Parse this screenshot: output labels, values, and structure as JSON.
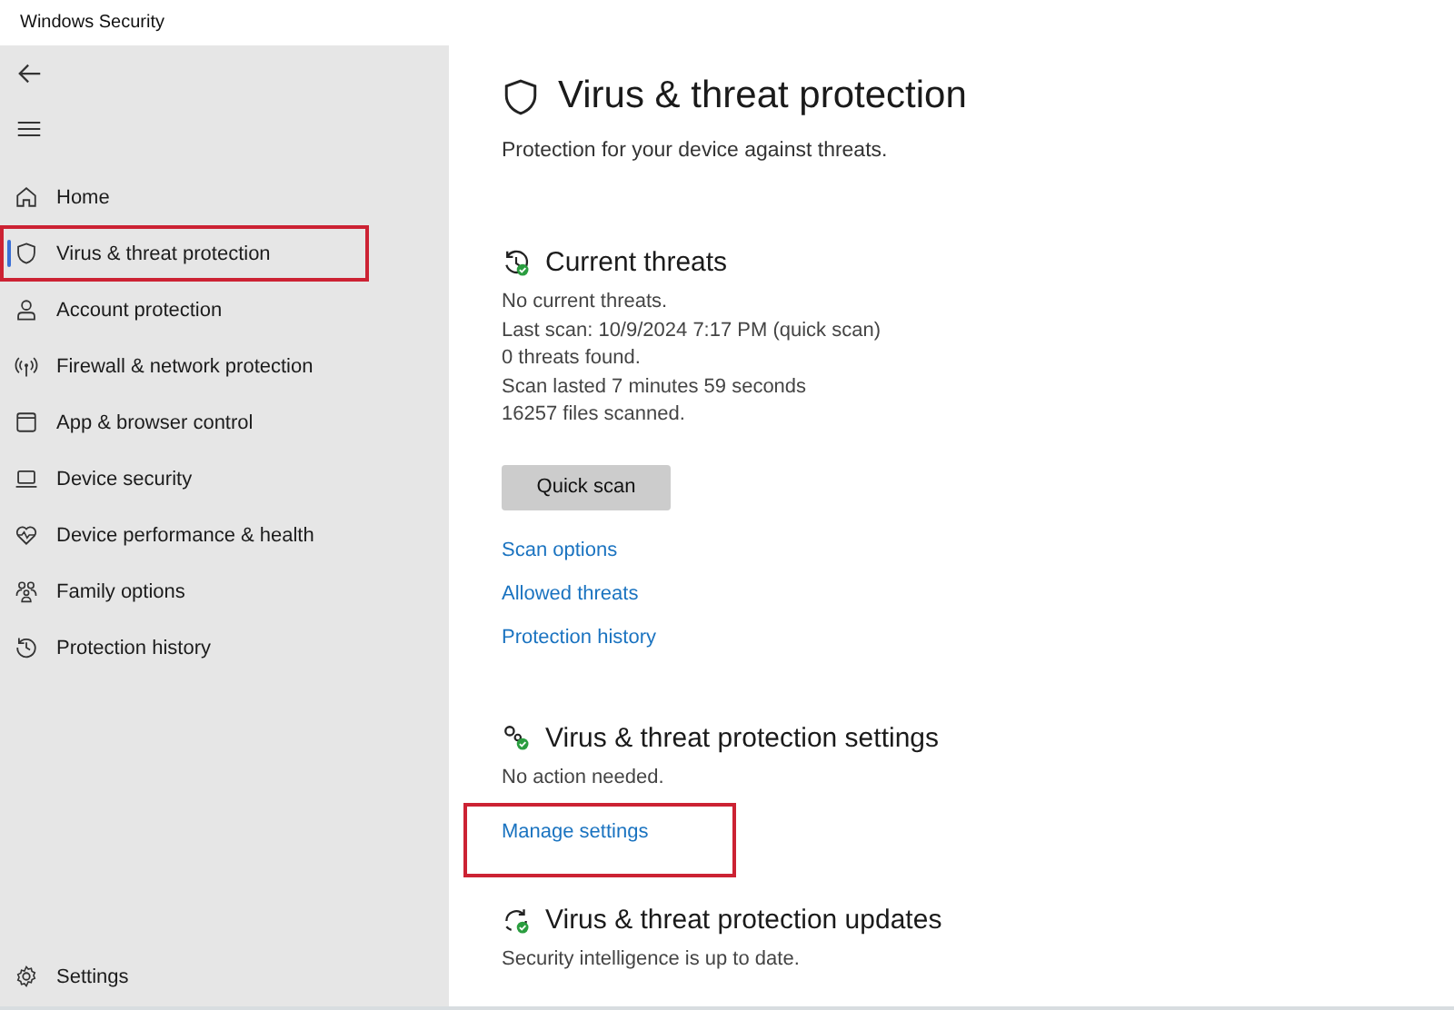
{
  "window": {
    "title": "Windows Security"
  },
  "sidebar": {
    "items": [
      {
        "label": "Home",
        "selected": false,
        "highlighted": false
      },
      {
        "label": "Virus & threat protection",
        "selected": true,
        "highlighted": true
      },
      {
        "label": "Account protection",
        "selected": false,
        "highlighted": false
      },
      {
        "label": "Firewall & network protection",
        "selected": false,
        "highlighted": false
      },
      {
        "label": "App & browser control",
        "selected": false,
        "highlighted": false
      },
      {
        "label": "Device security",
        "selected": false,
        "highlighted": false
      },
      {
        "label": "Device performance & health",
        "selected": false,
        "highlighted": false
      },
      {
        "label": "Family options",
        "selected": false,
        "highlighted": false
      },
      {
        "label": "Protection history",
        "selected": false,
        "highlighted": false
      }
    ],
    "settings": {
      "label": "Settings"
    }
  },
  "page": {
    "title": "Virus & threat protection",
    "subtitle": "Protection for your device against threats."
  },
  "sections": [
    {
      "title": "Current threats",
      "lines": [
        "No current threats.",
        "Last scan: 10/9/2024 7:17 PM (quick scan)",
        "0 threats found.",
        "Scan lasted 7 minutes 59 seconds",
        "16257 files scanned."
      ],
      "button": "Quick scan",
      "links": [
        {
          "label": "Scan options",
          "highlighted": false
        },
        {
          "label": "Allowed threats",
          "highlighted": false
        },
        {
          "label": "Protection history",
          "highlighted": false
        }
      ]
    },
    {
      "title": "Virus & threat protection settings",
      "lines": [
        "No action needed."
      ],
      "links": [
        {
          "label": "Manage settings",
          "highlighted": true
        }
      ]
    },
    {
      "title": "Virus & threat protection updates",
      "lines": [
        "Security intelligence is up to date."
      ]
    }
  ]
}
